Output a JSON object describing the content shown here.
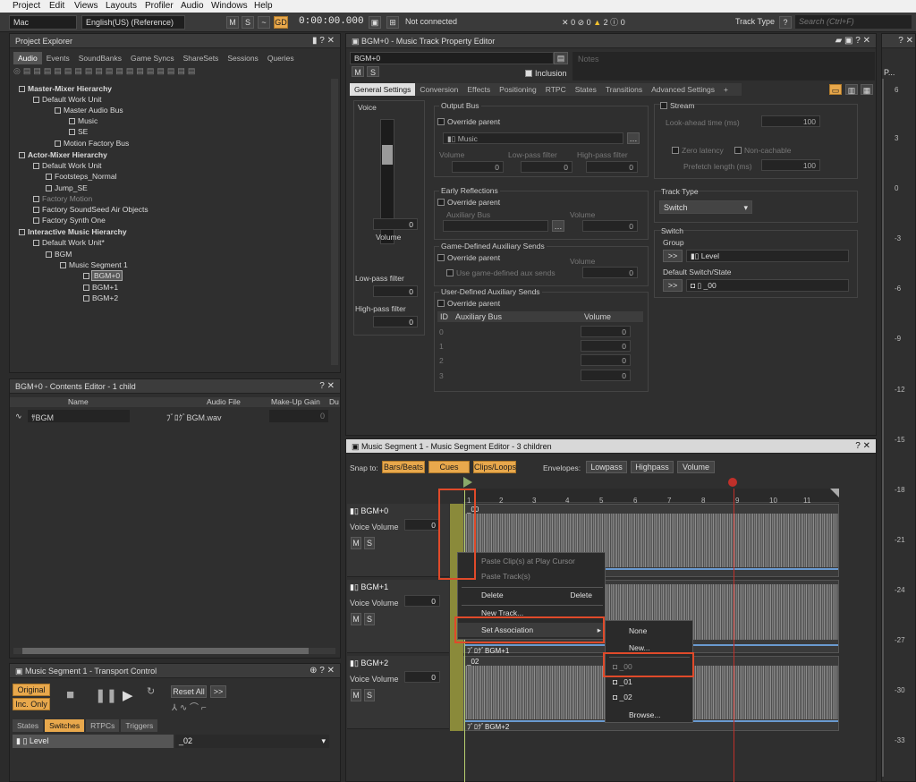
{
  "menu": [
    "Project",
    "Edit",
    "Views",
    "Layouts",
    "Profiler",
    "Audio",
    "Windows",
    "Help"
  ],
  "toolbar": {
    "platform": "Mac",
    "language": "English(US) (Reference)",
    "m": "M",
    "s": "S",
    "timecode": "0:00:00.000",
    "connection": "Not connected",
    "counts": [
      "0",
      "0",
      "2",
      "0"
    ],
    "track_type_label": "Track Type",
    "help": "?",
    "search_placeholder": "Search (Ctrl+F)"
  },
  "project_explorer": {
    "title": "Project Explorer",
    "tabs": [
      "Audio",
      "Events",
      "SoundBanks",
      "Game Syncs",
      "ShareSets",
      "Sessions",
      "Queries"
    ],
    "tree": [
      "Master-Mixer Hierarchy",
      "Default Work Unit",
      "Master Audio Bus",
      "Music",
      "SE",
      "Motion Factory Bus",
      "Actor-Mixer Hierarchy",
      "Default Work Unit",
      "Footsteps_Normal",
      "Jump_SE",
      "Factory Motion",
      "Factory SoundSeed Air Objects",
      "Factory Synth One",
      "Interactive Music Hierarchy",
      "Default Work Unit*",
      "BGM",
      "Music Segment 1",
      "BGM+0",
      "BGM+1",
      "BGM+2"
    ]
  },
  "contents_editor": {
    "title": "BGM+0 - Contents Editor - 1 child",
    "cols": [
      "Name",
      "Audio File",
      "Make-Up Gain",
      "Du"
    ],
    "row": {
      "name": "ｻBGM",
      "file": "ﾌﾞﾛｸﾞBGM.wav",
      "gain": "0"
    }
  },
  "transport": {
    "title": "Music Segment 1 - Transport Control",
    "original": "Original",
    "inc_only": "Inc. Only",
    "reset_all": "Reset All",
    "more": ">>",
    "tabs": [
      "States",
      "Switches",
      "RTPCs",
      "Triggers"
    ],
    "row_label": "Level",
    "row_value": "_02"
  },
  "property_editor": {
    "title": "BGM+0 - Music Track Property Editor",
    "name": "BGM+0",
    "notes_placeholder": "Notes",
    "m": "M",
    "s": "S",
    "inclusion": "Inclusion",
    "tabs": [
      "General Settings",
      "Conversion",
      "Effects",
      "Positioning",
      "RTPC",
      "States",
      "Transitions",
      "Advanced Settings",
      "+"
    ],
    "voice": {
      "label": "Voice",
      "value": "0",
      "volume": "Volume",
      "lowpass": "Low-pass filter",
      "lowpass_val": "0",
      "highpass": "High-pass filter",
      "highpass_val": "0"
    },
    "output_bus": {
      "title": "Output Bus",
      "override": "Override parent",
      "bus": "Music",
      "volume": "Volume",
      "lpf": "Low-pass filter",
      "hpf": "High-pass filter",
      "v": "0"
    },
    "early_reflections": {
      "title": "Early Reflections",
      "override": "Override parent",
      "aux": "Auxiliary Bus",
      "volume": "Volume",
      "v": "0"
    },
    "game_aux": {
      "title": "Game-Defined Auxiliary Sends",
      "override": "Override parent",
      "use": "Use game-defined aux sends",
      "volume": "Volume",
      "v": "0"
    },
    "user_aux": {
      "title": "User-Defined Auxiliary Sends",
      "override": "Override parent",
      "cols": [
        "ID",
        "Auxiliary Bus",
        "Volume"
      ],
      "ids": [
        "0",
        "1",
        "2",
        "3"
      ],
      "v": "0"
    },
    "stream": {
      "label": "Stream",
      "lookahead": "Look-ahead time (ms)",
      "lookahead_val": "100",
      "zero": "Zero latency",
      "noncache": "Non-cachable",
      "prefetch": "Prefetch length (ms)",
      "prefetch_val": "100"
    },
    "track_type": {
      "label": "Track Type",
      "value": "Switch"
    },
    "switch": {
      "title": "Switch",
      "group": "Group",
      "group_val": "Level",
      "default": "Default Switch/State",
      "default_val": "_00",
      "arrow": ">>"
    }
  },
  "segment_editor": {
    "title": "Music Segment 1 - Music Segment Editor - 3 children",
    "snap": "Snap to:",
    "snaps": [
      "Bars/Beats",
      "Cues",
      "Clips/Loops"
    ],
    "envelopes": "Envelopes:",
    "env": [
      "Lowpass",
      "Highpass",
      "Volume"
    ],
    "ruler": [
      "1",
      "2",
      "3",
      "4",
      "5",
      "6",
      "7",
      "8",
      "9",
      "10",
      "11"
    ],
    "tracks": [
      {
        "name": "BGM+0",
        "vol": "Voice Volume",
        "v": "0",
        "clip": "_00"
      },
      {
        "name": "BGM+1",
        "vol": "Voice Volume",
        "v": "0",
        "clip": "ﾌﾞﾛｸﾞBGM+1"
      },
      {
        "name": "BGM+2",
        "vol": "Voice Volume",
        "v": "0",
        "clip": "ﾌﾞﾛｸﾞBGM+2",
        "clip_top": "_02"
      }
    ],
    "m": "M",
    "s": "S"
  },
  "context_menu": {
    "items": [
      "Paste Clip(s) at Play Cursor",
      "Paste Track(s)",
      "Delete",
      "New Track...",
      "Set Association"
    ],
    "delete_shortcut": "Delete"
  },
  "submenu": {
    "items": [
      "None",
      "New...",
      "_00",
      "_01",
      "_02",
      "Browse..."
    ]
  },
  "vscale": [
    "6",
    "3",
    "0",
    "-3",
    "-6",
    "-9",
    "-12",
    "-15",
    "-18",
    "-21",
    "-24",
    "-27",
    "-30",
    "-33"
  ],
  "meter_label": "P..."
}
